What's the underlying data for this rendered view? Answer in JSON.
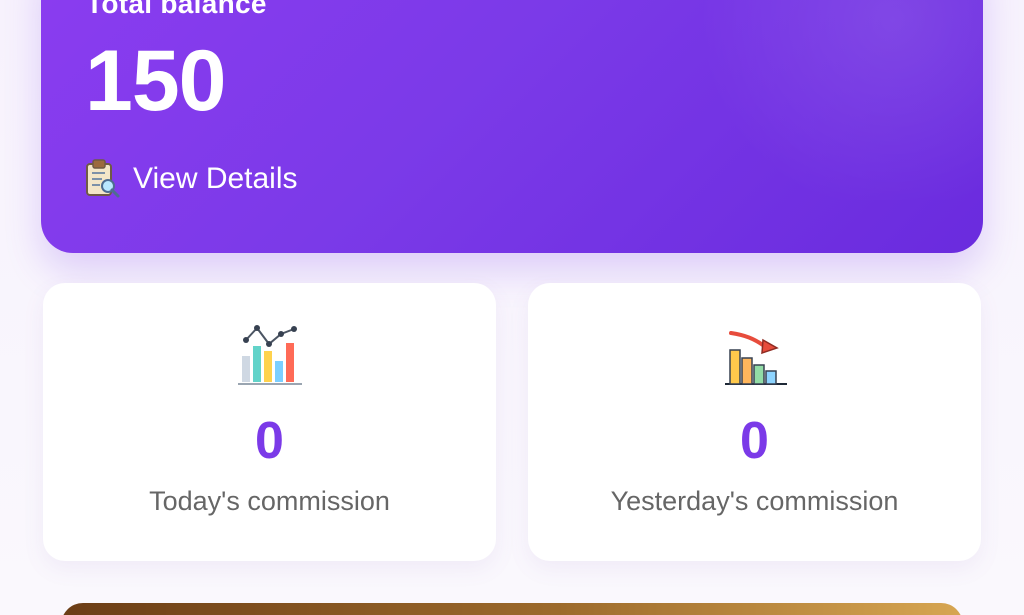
{
  "balance_card": {
    "label": "Total balance",
    "value": "150",
    "details_label": "View Details",
    "details_icon": "clipboard-search-icon",
    "colors": {
      "gradient_start": "#8b3cf0",
      "gradient_end": "#6a2bde"
    }
  },
  "stats": [
    {
      "value": "0",
      "label": "Today's commission",
      "icon": "chart-growth-icon"
    },
    {
      "value": "0",
      "label": "Yesterday's commission",
      "icon": "chart-decline-icon"
    }
  ],
  "accent_color": "#7b3ae8",
  "bottom_banner_color": "#9c6a2c"
}
